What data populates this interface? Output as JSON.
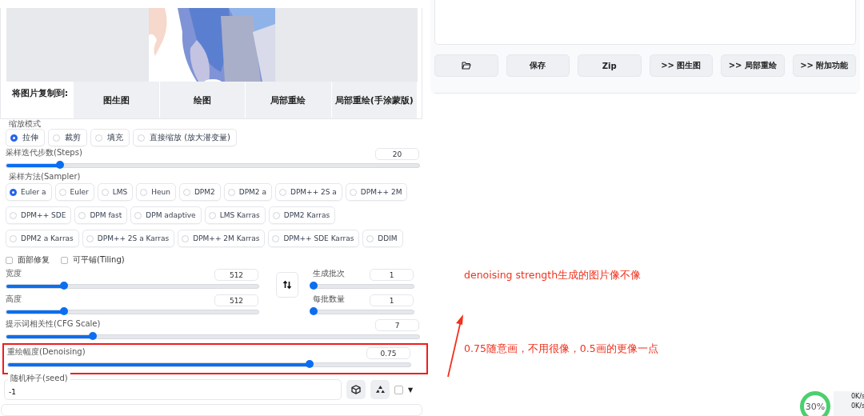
{
  "image_panel": {
    "copy_label": "将图片复制到:",
    "copy_buttons": [
      "图生图",
      "绘图",
      "局部重绘",
      "局部重绘(手涂蒙版)"
    ]
  },
  "resize_mode": {
    "label": "缩放模式",
    "options": [
      {
        "label": "拉伸",
        "selected": true
      },
      {
        "label": "裁剪",
        "selected": false
      },
      {
        "label": "填充",
        "selected": false
      },
      {
        "label": "直接缩放 (放大潜变量)",
        "selected": false
      }
    ]
  },
  "steps": {
    "label": "采样迭代步数(Steps)",
    "value": "20",
    "level": 0.13
  },
  "sampler": {
    "label": "采样方法(Sampler)",
    "options": [
      {
        "label": "Euler a",
        "selected": true
      },
      {
        "label": "Euler",
        "selected": false
      },
      {
        "label": "LMS",
        "selected": false
      },
      {
        "label": "Heun",
        "selected": false
      },
      {
        "label": "DPM2",
        "selected": false
      },
      {
        "label": "DPM2 a",
        "selected": false
      },
      {
        "label": "DPM++ 2S a",
        "selected": false
      },
      {
        "label": "DPM++ 2M",
        "selected": false
      },
      {
        "label": "DPM++ SDE",
        "selected": false
      },
      {
        "label": "DPM fast",
        "selected": false
      },
      {
        "label": "DPM adaptive",
        "selected": false
      },
      {
        "label": "LMS Karras",
        "selected": false
      },
      {
        "label": "DPM2 Karras",
        "selected": false
      },
      {
        "label": "DPM2 a Karras",
        "selected": false
      },
      {
        "label": "DPM++ 2S a Karras",
        "selected": false
      },
      {
        "label": "DPM++ 2M Karras",
        "selected": false
      },
      {
        "label": "DPM++ SDE Karras",
        "selected": false
      },
      {
        "label": "DDIM",
        "selected": false
      }
    ]
  },
  "checkboxes": [
    {
      "label": "面部修复",
      "checked": false
    },
    {
      "label": "可平铺(Tiling)",
      "checked": false
    }
  ],
  "width": {
    "label": "宽度",
    "value": "512",
    "level": 0.23
  },
  "height": {
    "label": "高度",
    "value": "512",
    "level": 0.23
  },
  "batch_count": {
    "label": "生成批次",
    "value": "1",
    "level": 0
  },
  "batch_size": {
    "label": "每批数量",
    "value": "1",
    "level": 0
  },
  "cfg": {
    "label": "提示词相关性(CFG Scale)",
    "value": "7",
    "level": 0.21
  },
  "denoising": {
    "label": "重绘幅度(Denoising)",
    "value": "0.75",
    "level": 0.75,
    "highlighted": true
  },
  "seed": {
    "label": "随机种子(seed)",
    "value": "-1",
    "extra_checked": false,
    "toggle": "▼"
  },
  "output_buttons": [
    {
      "kind": "folder"
    },
    {
      "kind": "text",
      "label": "保存"
    },
    {
      "kind": "text",
      "label": "Zip"
    },
    {
      "kind": "text",
      "label": ">> 图生图"
    },
    {
      "kind": "text",
      "label": ">> 局部重绘"
    },
    {
      "kind": "text",
      "label": ">> 附加功能"
    }
  ],
  "annotations": [
    "denoising strength生成的图片像不像",
    "0.75随意画，不用很像，0.5画的更像一点"
  ],
  "system_widget": {
    "percent": "30%",
    "upload": "0K/s",
    "download": "0K/s"
  }
}
